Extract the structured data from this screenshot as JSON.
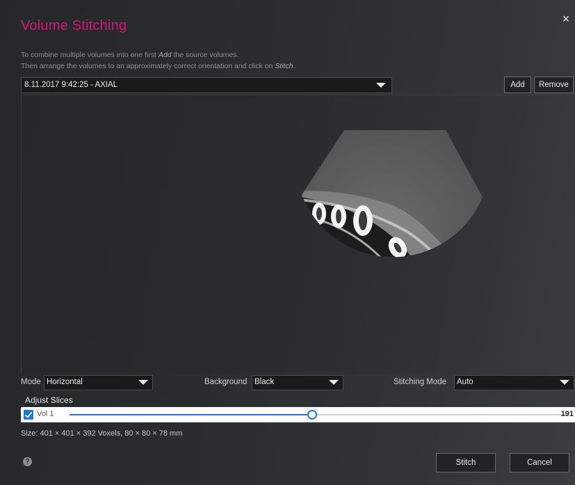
{
  "dialog": {
    "title": "Volume Stitching",
    "close_glyph": "×",
    "instructions": {
      "line1_pre": "To combine multiple volumes into one first ",
      "line1_em": "Add",
      "line1_post": " the source volumes.",
      "line2_pre": "Then arrange the volumes to an approximately correct orientation and click on ",
      "line2_em": "Stitch",
      "line2_post": "."
    }
  },
  "volume_select": {
    "selected": "8.11.2017 9:42:25 - AXIAL"
  },
  "toolbar": {
    "add_label": "Add",
    "remove_label": "Remove"
  },
  "controls": {
    "mode": {
      "label": "Mode",
      "value": "Horizontal"
    },
    "background": {
      "label": "Background",
      "value": "Black"
    },
    "stitching_mode": {
      "label": "Stitching Mode",
      "value": "Auto"
    }
  },
  "adjust": {
    "label": "Adjust Slices",
    "volumes": [
      {
        "name": "Vol 1",
        "checked": true,
        "value": "191",
        "fraction": 0.487
      }
    ]
  },
  "size_info": "Size: 401 × 401 × 392 Voxels, 80 × 80 × 78 mm",
  "footer": {
    "help_glyph": "?",
    "stitch_label": "Stitch",
    "cancel_label": "Cancel"
  },
  "colors": {
    "title": "#d8167a",
    "accent": "#1f7ad6"
  },
  "icons": {
    "close": "close-icon",
    "dropdown": "chevron-down-icon",
    "help": "help-icon",
    "check": "check-icon"
  }
}
